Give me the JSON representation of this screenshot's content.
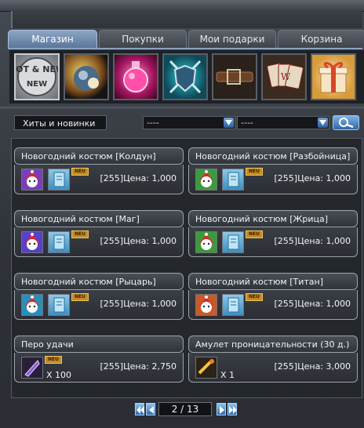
{
  "tabs": [
    {
      "label": "Магазин",
      "active": true
    },
    {
      "label": "Покупки",
      "active": false
    },
    {
      "label": "Мои подарки",
      "active": false
    },
    {
      "label": "Корзина",
      "active": false
    }
  ],
  "categories": [
    {
      "name": "hot-new",
      "icon": "hot-new-icon",
      "text": "HOT & NEW",
      "selected": true
    },
    {
      "name": "planet",
      "icon": "planet-icon",
      "selected": false
    },
    {
      "name": "potion",
      "icon": "potion-icon",
      "selected": false
    },
    {
      "name": "weapons",
      "icon": "shield-swords-icon",
      "selected": false
    },
    {
      "name": "belt",
      "icon": "belt-icon",
      "selected": false
    },
    {
      "name": "cards",
      "icon": "cards-icon",
      "selected": false
    },
    {
      "name": "gift",
      "icon": "gift-box-icon",
      "selected": false
    }
  ],
  "filter": {
    "category_label": "Хиты и новинки",
    "select1_value": "----",
    "select2_value": "----"
  },
  "items": [
    {
      "title": "Новогодний костюм [Колдун]",
      "price": "[255]Цена: 1,000",
      "new": "NEU",
      "type": "outfit",
      "accent": "#7a3fb8"
    },
    {
      "title": "Новогодний костюм [Разбойница]",
      "price": "[255]Цена: 1,000",
      "new": "NEU",
      "type": "outfit",
      "accent": "#3b9b3b"
    },
    {
      "title": "Новогодний костюм [Маг]",
      "price": "[255]Цена: 1,000",
      "new": "NEU",
      "type": "outfit",
      "accent": "#5a3fc8"
    },
    {
      "title": "Новогодний костюм [Жрица]",
      "price": "[255]Цена: 1,000",
      "new": "NEU",
      "type": "outfit",
      "accent": "#3b9b3b"
    },
    {
      "title": "Новогодний костюм [Рыцарь]",
      "price": "[255]Цена: 1,000",
      "new": "NEU",
      "type": "outfit",
      "accent": "#2a8fb8"
    },
    {
      "title": "Новогодний костюм [Титан]",
      "price": "[255]Цена: 1,000",
      "new": "NEU",
      "type": "outfit",
      "accent": "#c85a2a"
    },
    {
      "title": "Перо удачи",
      "price": "[255]Цена: 2,750",
      "new": "NEU",
      "type": "feather",
      "qty": "X 100",
      "accent": "#8a5fd0"
    },
    {
      "title": "Амулет проницательности (30 д.)",
      "price": "[255]Цена: 3,000",
      "type": "amulet",
      "qty": "X 1",
      "accent": "#d09a2a"
    }
  ],
  "pager": {
    "label": "2 / 13"
  }
}
